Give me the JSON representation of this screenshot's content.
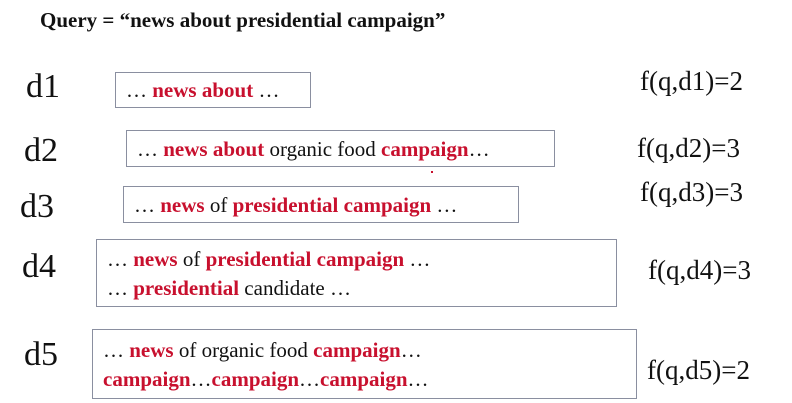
{
  "query": "Query = “news about presidential campaign”",
  "documents": [
    {
      "label": "d1",
      "score": "f(q,d1)=2",
      "lines": [
        [
          {
            "t": "… ",
            "h": false
          },
          {
            "t": "news about",
            "h": true
          },
          {
            "t": " …",
            "h": false
          }
        ]
      ]
    },
    {
      "label": "d2",
      "score": "f(q,d2)=3",
      "lines": [
        [
          {
            "t": "… ",
            "h": false
          },
          {
            "t": "news about",
            "h": true
          },
          {
            "t": " organic food ",
            "h": false
          },
          {
            "t": "campaign",
            "h": true
          },
          {
            "t": "…",
            "h": false
          }
        ]
      ]
    },
    {
      "label": "d3",
      "score": "f(q,d3)=3",
      "lines": [
        [
          {
            "t": "… ",
            "h": false
          },
          {
            "t": "news",
            "h": true
          },
          {
            "t": " of ",
            "h": false
          },
          {
            "t": "presidential campaign",
            "h": true
          },
          {
            "t": " …",
            "h": false
          }
        ]
      ]
    },
    {
      "label": "d4",
      "score": "f(q,d4)=3",
      "lines": [
        [
          {
            "t": "… ",
            "h": false
          },
          {
            "t": "news",
            "h": true
          },
          {
            "t": " of ",
            "h": false
          },
          {
            "t": "presidential campaign",
            "h": true
          },
          {
            "t": " …",
            "h": false
          }
        ],
        [
          {
            "t": "… ",
            "h": false
          },
          {
            "t": "presidential",
            "h": true
          },
          {
            "t": " candidate …",
            "h": false
          }
        ]
      ]
    },
    {
      "label": "d5",
      "score": "f(q,d5)=2",
      "lines": [
        [
          {
            "t": "… ",
            "h": false
          },
          {
            "t": "news",
            "h": true
          },
          {
            "t": " of organic food ",
            "h": false
          },
          {
            "t": "campaign",
            "h": true
          },
          {
            "t": "…",
            "h": false
          }
        ],
        [
          {
            "t": "campaign",
            "h": true
          },
          {
            "t": "…",
            "h": false
          },
          {
            "t": "campaign",
            "h": true
          },
          {
            "t": "…",
            "h": false
          },
          {
            "t": "campaign",
            "h": true
          },
          {
            "t": "…",
            "h": false
          }
        ]
      ]
    }
  ],
  "colors": {
    "highlight": "#c8102e",
    "box_border": "#8a8fa0",
    "text": "#111111"
  }
}
